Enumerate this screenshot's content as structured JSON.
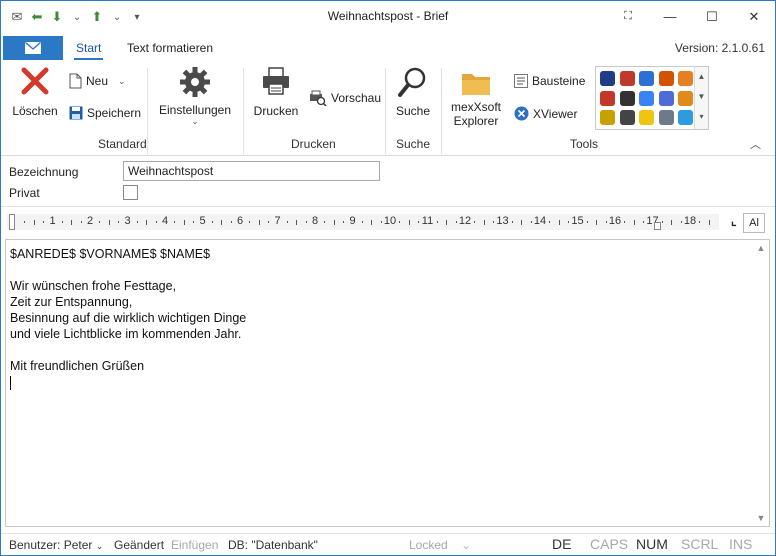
{
  "window": {
    "title": "Weihnachtspost - Brief",
    "quick_access": [
      {
        "icon": "envelope-icon",
        "glyph": "✉"
      },
      {
        "icon": "arrow-left-icon",
        "glyph": "⬅"
      },
      {
        "icon": "arrow-down-icon",
        "glyph": "⬇"
      },
      {
        "icon": "dropdown-arrow-icon",
        "glyph": "⌄"
      },
      {
        "icon": "arrow-up-icon",
        "glyph": "⬆"
      },
      {
        "icon": "dropdown-arrow-icon",
        "glyph": "⌄"
      },
      {
        "icon": "customize-icon",
        "glyph": "▾"
      }
    ],
    "controls": {
      "pin": "⛶",
      "minimize": "—",
      "maximize": "☐",
      "close": "✕"
    }
  },
  "ribbon_tabs": {
    "tabs": [
      "Start",
      "Text formatieren"
    ],
    "active": "Start",
    "version": "Version: 2.1.0.61"
  },
  "ribbon": {
    "loeschen": "Löschen",
    "neu": "Neu",
    "speichern": "Speichern",
    "einstellungen": "Einstellungen",
    "drucken": "Drucken",
    "vorschau": "Vorschau",
    "suche": "Suche",
    "explorer_line1": "mexXsoft",
    "explorer_line2": "Explorer",
    "bausteine": "Bausteine",
    "xviewer": "XViewer",
    "groups": {
      "standard": "Standard",
      "drucken": "Drucken",
      "suche": "Suche",
      "tools": "Tools"
    },
    "gallery_colors": [
      "#1f3c88",
      "#c0392b",
      "#2e6fd6",
      "#d35400",
      "#e67e22",
      "#c0392b",
      "#333333",
      "#3b82f6",
      "#4f6bd8",
      "#e08a1e",
      "#c8a000",
      "#444444",
      "#f1c40f",
      "#6c7a89",
      "#2e9be0"
    ]
  },
  "form": {
    "bezeichnung_label": "Bezeichnung",
    "bezeichnung_value": "Weihnachtspost",
    "privat_label": "Privat"
  },
  "ruler": {
    "numbers": [
      "1",
      "2",
      "3",
      "4",
      "5",
      "6",
      "7",
      "8",
      "9",
      "10",
      "11",
      "12",
      "13",
      "14",
      "15",
      "16",
      "17",
      "18"
    ],
    "align_button": "Al"
  },
  "editor": {
    "lines": [
      "$ANREDE$ $VORNAME$ $NAME$",
      "",
      "Wir wünschen frohe Festtage,",
      "Zeit zur Entspannung,",
      "Besinnung auf die wirklich wichtigen Dinge",
      "und viele Lichtblicke im kommenden Jahr.",
      "",
      "Mit freundlichen Grüßen"
    ]
  },
  "statusbar": {
    "benutzer": "Benutzer: Peter",
    "geaendert": "Geändert",
    "einfuegen": "Einfügen",
    "db": "DB: \"Datenbank\"",
    "locked": "Locked",
    "lang": "DE",
    "caps": "CAPS",
    "num": "NUM",
    "scrl": "SCRL",
    "ins": "INS"
  }
}
